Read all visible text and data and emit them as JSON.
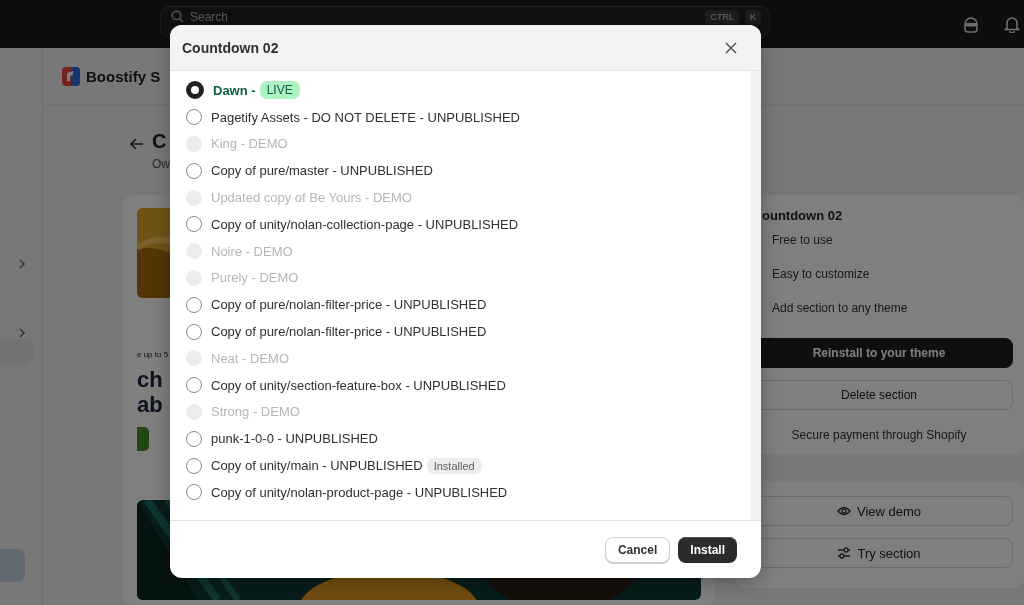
{
  "top_bar": {
    "search": {
      "placeholder": "Search",
      "shortcut": [
        "CTRL",
        "K"
      ]
    }
  },
  "header": {
    "app_name": "Boostify S"
  },
  "page": {
    "title": "C",
    "subtitle": "Ow"
  },
  "preview": {
    "eyebrow": "e up to 5",
    "headline": [
      "ch",
      "ab"
    ]
  },
  "details": {
    "title": "ountdown 02",
    "features": [
      "Free to use",
      "Easy to customize",
      "Add section to any theme"
    ],
    "buttons": [
      {
        "label": "Reinstall to your theme",
        "kind": "primary"
      },
      {
        "label": "Delete section",
        "kind": "secondary"
      }
    ],
    "note": "Secure payment through Shopify"
  },
  "demo_actions": [
    "View demo",
    "Try section"
  ],
  "modal": {
    "title": "Countdown 02",
    "themes": [
      {
        "label": "Dawn -",
        "badge": {
          "text": "LIVE",
          "kind": "live"
        },
        "selected": true,
        "disabled": false
      },
      {
        "label": "Pagetify Assets - DO NOT DELETE - UNPUBLISHED",
        "selected": false,
        "disabled": false
      },
      {
        "label": "King - DEMO",
        "selected": false,
        "disabled": true
      },
      {
        "label": "Copy of pure/master - UNPUBLISHED",
        "selected": false,
        "disabled": false
      },
      {
        "label": "Updated copy of Be Yours - DEMO",
        "selected": false,
        "disabled": true
      },
      {
        "label": "Copy of unity/nolan-collection-page - UNPUBLISHED",
        "selected": false,
        "disabled": false
      },
      {
        "label": "Noire - DEMO",
        "selected": false,
        "disabled": true
      },
      {
        "label": "Purely - DEMO",
        "selected": false,
        "disabled": true
      },
      {
        "label": "Copy of pure/nolan-filter-price - UNPUBLISHED",
        "selected": false,
        "disabled": false
      },
      {
        "label": "Copy of pure/nolan-filter-price - UNPUBLISHED",
        "selected": false,
        "disabled": false
      },
      {
        "label": "Neat - DEMO",
        "selected": false,
        "disabled": true
      },
      {
        "label": "Copy of unity/section-feature-box - UNPUBLISHED",
        "selected": false,
        "disabled": false
      },
      {
        "label": "Strong - DEMO",
        "selected": false,
        "disabled": true
      },
      {
        "label": "punk-1-0-0 - UNPUBLISHED",
        "selected": false,
        "disabled": false
      },
      {
        "label": "Copy of unity/main - UNPUBLISHED",
        "badge": {
          "text": "Installed",
          "kind": "installed"
        },
        "selected": false,
        "disabled": false
      },
      {
        "label": "Copy of unity/nolan-product-page - UNPUBLISHED",
        "selected": false,
        "disabled": false
      }
    ],
    "buttons": [
      {
        "label": "Cancel",
        "kind": "secondary"
      },
      {
        "label": "Install",
        "kind": "primary"
      }
    ]
  }
}
